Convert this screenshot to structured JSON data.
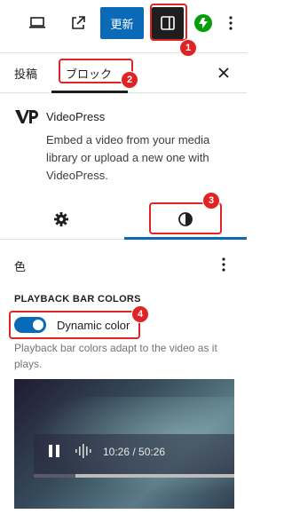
{
  "toolbar": {
    "preview_icon": "laptop-icon",
    "external_icon": "external-link-icon",
    "update_label": "更新",
    "settings_icon": "sidebar-toggle-icon",
    "jetpack_icon": "jetpack-bolt-icon",
    "more_icon": "vertical-ellipsis-icon"
  },
  "panel_tabs": {
    "post": "投稿",
    "block": "ブロック",
    "close_icon": "close-icon"
  },
  "block_card": {
    "icon": "videopress-logo-icon",
    "title": "VideoPress",
    "description": "Embed a video from your media library or upload a new one with VideoPress."
  },
  "inspector_tabs": {
    "settings_icon": "gear-icon",
    "styles_icon": "half-circle-contrast-icon",
    "active": "styles"
  },
  "color_panel": {
    "heading": "色",
    "more_icon": "vertical-ellipsis-icon",
    "subheading": "PLAYBACK BAR COLORS",
    "toggle_label": "Dynamic color",
    "toggle_on": true,
    "help": "Playback bar colors adapt to the video as it plays."
  },
  "preview": {
    "time": "10:26 / 50:26",
    "progress_fraction": 0.21,
    "play_icon": "pause-icon",
    "wave_icon": "audio-wave-icon"
  },
  "annotations": [
    "1",
    "2",
    "3",
    "4"
  ],
  "colors": {
    "accent": "#0a6ab7",
    "annotation": "#e02424",
    "jetpack": "#069e08",
    "dark": "#1e1e1e"
  }
}
